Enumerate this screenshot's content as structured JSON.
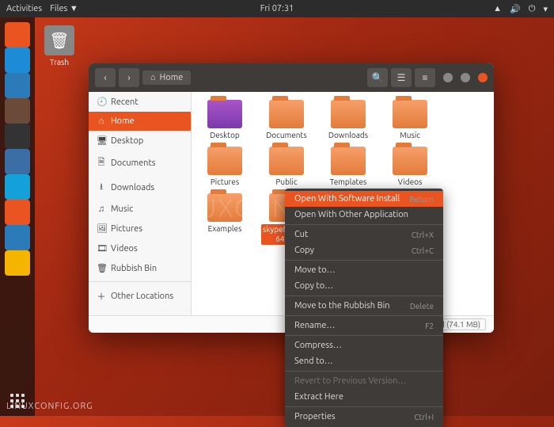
{
  "topbar": {
    "activities": "Activities",
    "app": "Files ▼",
    "clock": "Fri 07:31"
  },
  "desktop": {
    "trash": "Trash"
  },
  "window": {
    "path_icon": "⌂",
    "path": "Home",
    "sidebar": [
      {
        "icon": "🕘",
        "label": "Recent"
      },
      {
        "icon": "⌂",
        "label": "Home",
        "active": true
      },
      {
        "icon": "🖥",
        "label": "Desktop"
      },
      {
        "icon": "🗎",
        "label": "Documents"
      },
      {
        "icon": "⭳",
        "label": "Downloads"
      },
      {
        "icon": "♫",
        "label": "Music"
      },
      {
        "icon": "🖼",
        "label": "Pictures"
      },
      {
        "icon": "🎞",
        "label": "Videos"
      },
      {
        "icon": "🗑",
        "label": "Rubbish Bin"
      },
      {
        "icon": "＋",
        "label": "Other Locations",
        "sep": true
      }
    ],
    "items": [
      {
        "label": "Desktop",
        "variant": "desktop"
      },
      {
        "label": "Documents"
      },
      {
        "label": "Downloads"
      },
      {
        "label": "Music"
      },
      {
        "label": "Pictures"
      },
      {
        "label": "Public"
      },
      {
        "label": "Templates"
      },
      {
        "label": "Videos"
      },
      {
        "label": "Examples"
      },
      {
        "label": "skypeforlinux-64.deb",
        "selected": true
      }
    ],
    "status": "\"skypeforlinux-64.deb\" selected  (74.1 MB)"
  },
  "context_menu": [
    {
      "label": "Open With Software Install",
      "shortcut": "Return",
      "hi": true
    },
    {
      "label": "Open With Other Application"
    },
    {
      "sep": true
    },
    {
      "label": "Cut",
      "shortcut": "Ctrl+X"
    },
    {
      "label": "Copy",
      "shortcut": "Ctrl+C"
    },
    {
      "sep": true
    },
    {
      "label": "Move to…"
    },
    {
      "label": "Copy to…"
    },
    {
      "sep": true
    },
    {
      "label": "Move to the Rubbish Bin",
      "shortcut": "Delete"
    },
    {
      "sep": true
    },
    {
      "label": "Rename…",
      "shortcut": "F2"
    },
    {
      "sep": true
    },
    {
      "label": "Compress…"
    },
    {
      "label": "Send to…"
    },
    {
      "sep": true
    },
    {
      "label": "Revert to Previous Version…",
      "disabled": true
    },
    {
      "label": "Extract Here"
    },
    {
      "sep": true
    },
    {
      "label": "Properties",
      "shortcut": "Ctrl+I"
    }
  ],
  "watermark": "LINUXCONFIG.ORG",
  "dock_colors": [
    "#e95420",
    "#1e8bd6",
    "#2b7bb9",
    "#6b4a3a",
    "#333",
    "#3a6ea5",
    "#14a0d8",
    "#e95420",
    "#2b7bb9",
    "#f5b400"
  ]
}
